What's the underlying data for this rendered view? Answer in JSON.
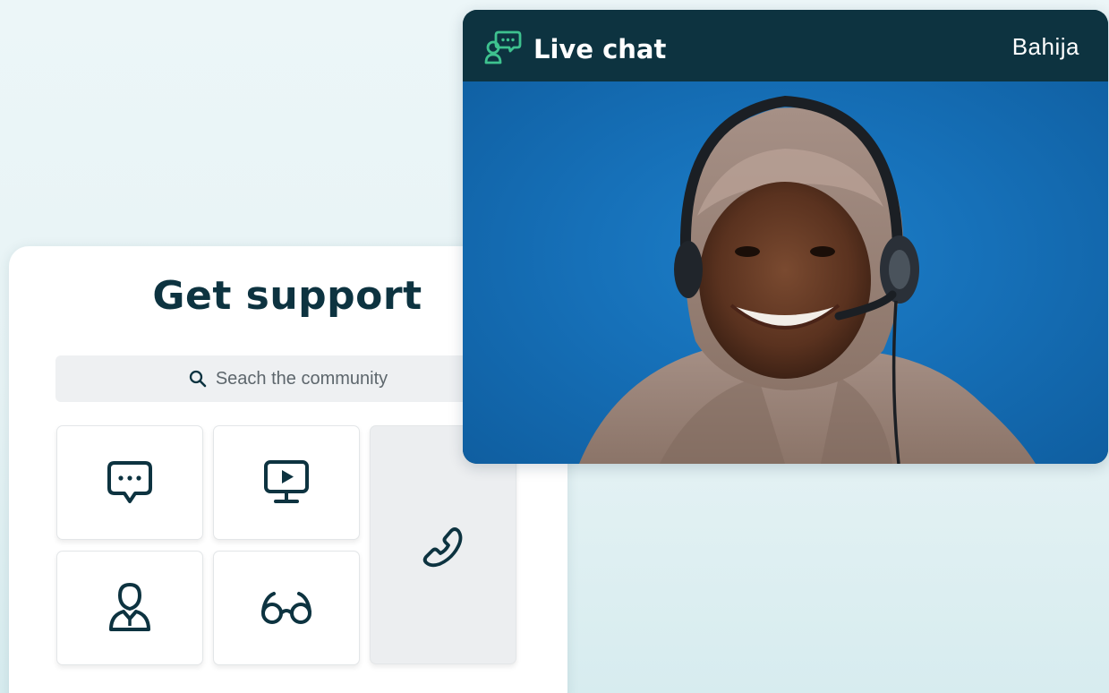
{
  "support": {
    "title": "Get support",
    "search_placeholder": "Seach the community",
    "tiles": [
      {
        "icon": "chat-bubble-icon"
      },
      {
        "icon": "video-monitor-icon"
      },
      {
        "icon": "phone-icon"
      },
      {
        "icon": "person-icon"
      },
      {
        "icon": "glasses-icon"
      }
    ]
  },
  "live_chat": {
    "title": "Live chat",
    "agent_name": "Bahija",
    "header_icon": "chat-agent-icon"
  },
  "colors": {
    "navy": "#0d3340",
    "accent_green": "#3ec28f",
    "video_blue": "#1670b8"
  }
}
